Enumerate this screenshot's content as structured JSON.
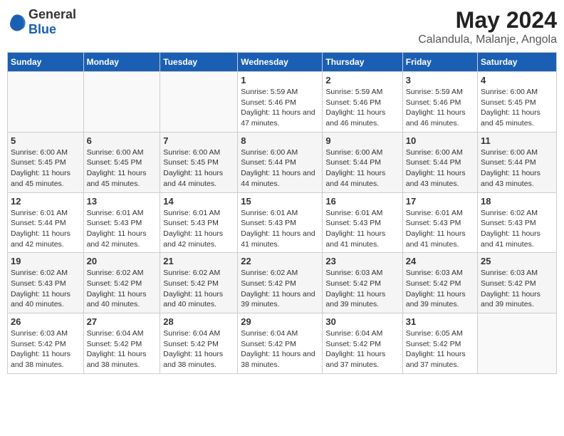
{
  "logo": {
    "text_general": "General",
    "text_blue": "Blue"
  },
  "title": "May 2024",
  "subtitle": "Calandula, Malanje, Angola",
  "days_of_week": [
    "Sunday",
    "Monday",
    "Tuesday",
    "Wednesday",
    "Thursday",
    "Friday",
    "Saturday"
  ],
  "weeks": [
    [
      {
        "day": "",
        "info": ""
      },
      {
        "day": "",
        "info": ""
      },
      {
        "day": "",
        "info": ""
      },
      {
        "day": "1",
        "info": "Sunrise: 5:59 AM\nSunset: 5:46 PM\nDaylight: 11 hours and 47 minutes."
      },
      {
        "day": "2",
        "info": "Sunrise: 5:59 AM\nSunset: 5:46 PM\nDaylight: 11 hours and 46 minutes."
      },
      {
        "day": "3",
        "info": "Sunrise: 5:59 AM\nSunset: 5:46 PM\nDaylight: 11 hours and 46 minutes."
      },
      {
        "day": "4",
        "info": "Sunrise: 6:00 AM\nSunset: 5:45 PM\nDaylight: 11 hours and 45 minutes."
      }
    ],
    [
      {
        "day": "5",
        "info": "Sunrise: 6:00 AM\nSunset: 5:45 PM\nDaylight: 11 hours and 45 minutes."
      },
      {
        "day": "6",
        "info": "Sunrise: 6:00 AM\nSunset: 5:45 PM\nDaylight: 11 hours and 45 minutes."
      },
      {
        "day": "7",
        "info": "Sunrise: 6:00 AM\nSunset: 5:45 PM\nDaylight: 11 hours and 44 minutes."
      },
      {
        "day": "8",
        "info": "Sunrise: 6:00 AM\nSunset: 5:44 PM\nDaylight: 11 hours and 44 minutes."
      },
      {
        "day": "9",
        "info": "Sunrise: 6:00 AM\nSunset: 5:44 PM\nDaylight: 11 hours and 44 minutes."
      },
      {
        "day": "10",
        "info": "Sunrise: 6:00 AM\nSunset: 5:44 PM\nDaylight: 11 hours and 43 minutes."
      },
      {
        "day": "11",
        "info": "Sunrise: 6:00 AM\nSunset: 5:44 PM\nDaylight: 11 hours and 43 minutes."
      }
    ],
    [
      {
        "day": "12",
        "info": "Sunrise: 6:01 AM\nSunset: 5:44 PM\nDaylight: 11 hours and 42 minutes."
      },
      {
        "day": "13",
        "info": "Sunrise: 6:01 AM\nSunset: 5:43 PM\nDaylight: 11 hours and 42 minutes."
      },
      {
        "day": "14",
        "info": "Sunrise: 6:01 AM\nSunset: 5:43 PM\nDaylight: 11 hours and 42 minutes."
      },
      {
        "day": "15",
        "info": "Sunrise: 6:01 AM\nSunset: 5:43 PM\nDaylight: 11 hours and 41 minutes."
      },
      {
        "day": "16",
        "info": "Sunrise: 6:01 AM\nSunset: 5:43 PM\nDaylight: 11 hours and 41 minutes."
      },
      {
        "day": "17",
        "info": "Sunrise: 6:01 AM\nSunset: 5:43 PM\nDaylight: 11 hours and 41 minutes."
      },
      {
        "day": "18",
        "info": "Sunrise: 6:02 AM\nSunset: 5:43 PM\nDaylight: 11 hours and 41 minutes."
      }
    ],
    [
      {
        "day": "19",
        "info": "Sunrise: 6:02 AM\nSunset: 5:43 PM\nDaylight: 11 hours and 40 minutes."
      },
      {
        "day": "20",
        "info": "Sunrise: 6:02 AM\nSunset: 5:42 PM\nDaylight: 11 hours and 40 minutes."
      },
      {
        "day": "21",
        "info": "Sunrise: 6:02 AM\nSunset: 5:42 PM\nDaylight: 11 hours and 40 minutes."
      },
      {
        "day": "22",
        "info": "Sunrise: 6:02 AM\nSunset: 5:42 PM\nDaylight: 11 hours and 39 minutes."
      },
      {
        "day": "23",
        "info": "Sunrise: 6:03 AM\nSunset: 5:42 PM\nDaylight: 11 hours and 39 minutes."
      },
      {
        "day": "24",
        "info": "Sunrise: 6:03 AM\nSunset: 5:42 PM\nDaylight: 11 hours and 39 minutes."
      },
      {
        "day": "25",
        "info": "Sunrise: 6:03 AM\nSunset: 5:42 PM\nDaylight: 11 hours and 39 minutes."
      }
    ],
    [
      {
        "day": "26",
        "info": "Sunrise: 6:03 AM\nSunset: 5:42 PM\nDaylight: 11 hours and 38 minutes."
      },
      {
        "day": "27",
        "info": "Sunrise: 6:04 AM\nSunset: 5:42 PM\nDaylight: 11 hours and 38 minutes."
      },
      {
        "day": "28",
        "info": "Sunrise: 6:04 AM\nSunset: 5:42 PM\nDaylight: 11 hours and 38 minutes."
      },
      {
        "day": "29",
        "info": "Sunrise: 6:04 AM\nSunset: 5:42 PM\nDaylight: 11 hours and 38 minutes."
      },
      {
        "day": "30",
        "info": "Sunrise: 6:04 AM\nSunset: 5:42 PM\nDaylight: 11 hours and 37 minutes."
      },
      {
        "day": "31",
        "info": "Sunrise: 6:05 AM\nSunset: 5:42 PM\nDaylight: 11 hours and 37 minutes."
      },
      {
        "day": "",
        "info": ""
      }
    ]
  ]
}
